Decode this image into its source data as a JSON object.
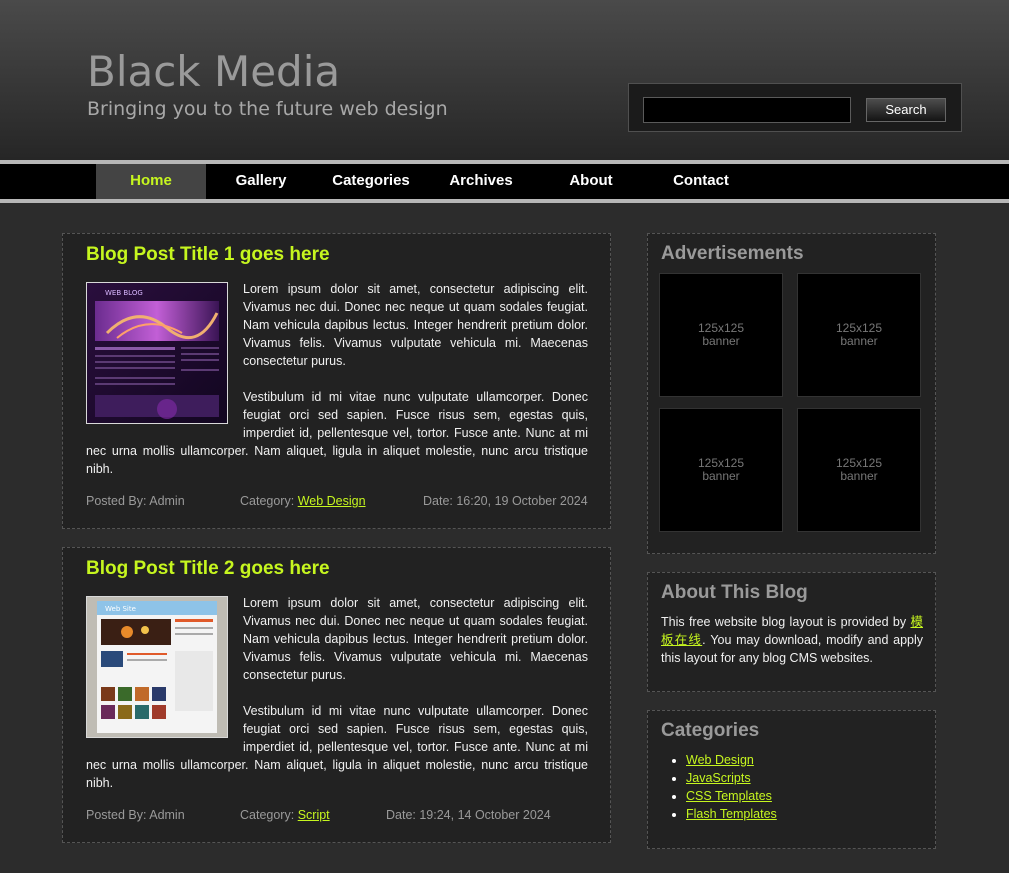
{
  "site": {
    "title": "Black Media",
    "tagline": "Bringing you to the future web design"
  },
  "search": {
    "placeholder": "",
    "button_label": "Search"
  },
  "nav": {
    "items": [
      {
        "label": "Home",
        "active": true
      },
      {
        "label": "Gallery",
        "active": false
      },
      {
        "label": "Categories",
        "active": false
      },
      {
        "label": "Archives",
        "active": false
      },
      {
        "label": "About",
        "active": false
      },
      {
        "label": "Contact",
        "active": false
      }
    ]
  },
  "posts": [
    {
      "title": "Blog Post Title 1 goes here",
      "paragraph1": "Lorem ipsum dolor sit amet, consectetur adipiscing elit. Vivamus nec dui. Donec nec neque ut quam sodales feugiat. Nam vehicula dapibus lectus. Integer hendrerit pretium dolor. Vivamus felis. Vivamus vulputate vehicula mi. Maecenas consectetur purus.",
      "paragraph2": "Vestibulum id mi vitae nunc vulputate ullamcorper. Donec feugiat orci sed sapien. Fusce risus sem, egestas quis, imperdiet id, pellentesque vel, tortor. Fusce ante. Nunc at mi nec urna mollis ullamcorper. Nam aliquet, ligula in aliquet molestie, nunc arcu tristique nibh.",
      "posted_by": "Posted By: Admin",
      "category_label": "Category:",
      "category": "Web Design",
      "date": "Date: 16:20, 19 October 2024"
    },
    {
      "title": "Blog Post Title 2 goes here",
      "paragraph1": "Lorem ipsum dolor sit amet, consectetur adipiscing elit. Vivamus nec dui. Donec nec neque ut quam sodales feugiat. Nam vehicula dapibus lectus. Integer hendrerit pretium dolor. Vivamus felis. Vivamus vulputate vehicula mi. Maecenas consectetur purus.",
      "paragraph2": "Vestibulum id mi vitae nunc vulputate ullamcorper. Donec feugiat orci sed sapien. Fusce risus sem, egestas quis, imperdiet id, pellentesque vel, tortor. Fusce ante. Nunc at mi nec urna mollis ullamcorper. Nam aliquet, ligula in aliquet molestie, nunc arcu tristique nibh.",
      "posted_by": "Posted By: Admin",
      "category_label": "Category:",
      "category": "Script",
      "date": "Date: 19:24, 14 October 2024"
    }
  ],
  "sidebar": {
    "ads": {
      "heading": "Advertisements",
      "banners": [
        {
          "line1": "125x125",
          "line2": "banner"
        },
        {
          "line1": "125x125",
          "line2": "banner"
        },
        {
          "line1": "125x125",
          "line2": "banner"
        },
        {
          "line1": "125x125",
          "line2": "banner"
        }
      ]
    },
    "about": {
      "heading": "About This Blog",
      "text_before": "This free website blog layout is provided by ",
      "link": "模板在线",
      "text_after": ". You may download, modify and apply this layout for any blog CMS websites."
    },
    "categories": {
      "heading": "Categories",
      "items": [
        "Web Design",
        "JavaScripts",
        "CSS Templates",
        "Flash Templates"
      ]
    }
  },
  "colors": {
    "accent": "#c6f61f",
    "background": "#2c2c2c",
    "panel": "#222222"
  }
}
